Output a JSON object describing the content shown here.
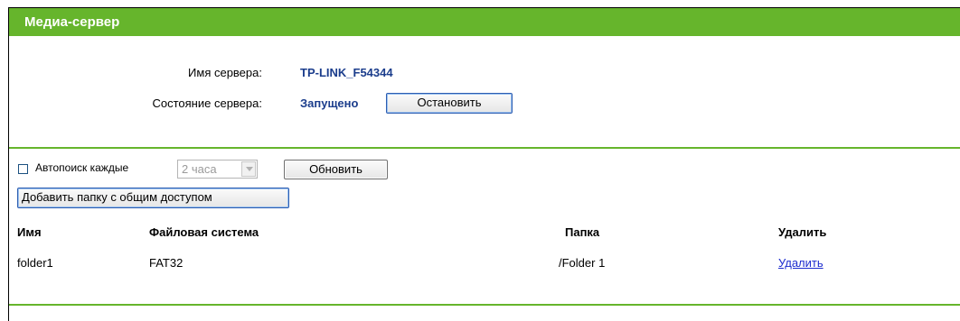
{
  "header": {
    "title": "Медиа-сервер"
  },
  "server": {
    "name_label": "Имя сервера:",
    "name_value": "TP-LINK_F54344",
    "status_label": "Состояние сервера:",
    "status_value": "Запущено",
    "stop_button": "Остановить"
  },
  "autoscan": {
    "checked": false,
    "label": "Автопоиск каждые",
    "interval_selected": "2 часа",
    "refresh_button": "Обновить"
  },
  "add_folder_button": "Добавить папку с общим доступом",
  "table": {
    "columns": [
      "Имя",
      "Файловая система",
      "Папка",
      "Удалить"
    ],
    "rows": [
      {
        "name": "folder1",
        "filesystem": "FAT32",
        "folder": "/Folder 1",
        "delete": "Удалить"
      }
    ]
  },
  "colors": {
    "header_green": "#66b52c",
    "value_blue": "#1b3d8c",
    "link_blue": "#1d2ccf"
  }
}
